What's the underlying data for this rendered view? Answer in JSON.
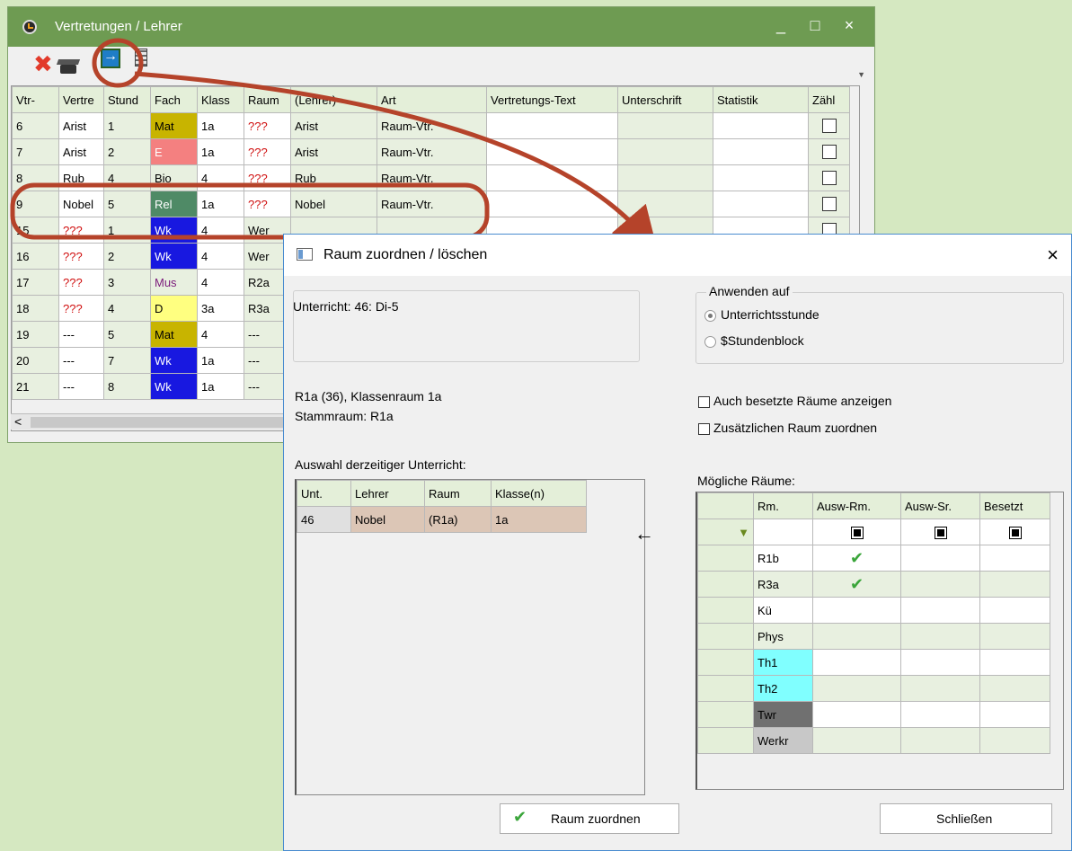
{
  "main_window": {
    "title": "Vertretungen / Lehrer",
    "controls": {
      "minimize": "_",
      "maximize": "□",
      "close": "×"
    },
    "toolbar_icons": [
      "delete-icon",
      "teacher-hat-icon",
      "assign-room-icon",
      "room-grid-icon"
    ],
    "columns": [
      "Vtr-",
      "Vertre",
      "Stund",
      "Fach",
      "Klass",
      "Raum",
      "(Lehrer)",
      "Art",
      "Vertretungs-Text",
      "Unterschrift",
      "Statistik",
      "Zähl"
    ],
    "rows": [
      {
        "vtr": "6",
        "vertr": "Arist",
        "stunde": "1",
        "fach": "Mat",
        "klasse": "1a",
        "raum": "???",
        "lehrer": "Arist",
        "art": "Raum-Vtr."
      },
      {
        "vtr": "7",
        "vertr": "Arist",
        "stunde": "2",
        "fach": "E",
        "klasse": "1a",
        "raum": "???",
        "lehrer": "Arist",
        "art": "Raum-Vtr."
      },
      {
        "vtr": "8",
        "vertr": "Rub",
        "stunde": "4",
        "fach": "Bio",
        "klasse": "4",
        "raum": "???",
        "lehrer": "Rub",
        "art": "Raum-Vtr."
      },
      {
        "vtr": "9",
        "vertr": "Nobel",
        "stunde": "5",
        "fach": "Rel",
        "klasse": "1a",
        "raum": "???",
        "lehrer": "Nobel",
        "art": "Raum-Vtr."
      },
      {
        "vtr": "15",
        "vertr": "???",
        "stunde": "1",
        "fach": "Wk",
        "klasse": "4",
        "raum": "Wer",
        "lehrer": "",
        "art": ""
      },
      {
        "vtr": "16",
        "vertr": "???",
        "stunde": "2",
        "fach": "Wk",
        "klasse": "4",
        "raum": "Wer",
        "lehrer": "",
        "art": ""
      },
      {
        "vtr": "17",
        "vertr": "???",
        "stunde": "3",
        "fach": "Mus",
        "klasse": "4",
        "raum": "R2a",
        "lehrer": "",
        "art": ""
      },
      {
        "vtr": "18",
        "vertr": "???",
        "stunde": "4",
        "fach": "D",
        "klasse": "3a",
        "raum": "R3a",
        "lehrer": "",
        "art": ""
      },
      {
        "vtr": "19",
        "vertr": "---",
        "stunde": "5",
        "fach": "Mat",
        "klasse": "4",
        "raum": "---",
        "lehrer": "",
        "art": ""
      },
      {
        "vtr": "20",
        "vertr": "---",
        "stunde": "7",
        "fach": "Wk",
        "klasse": "1a",
        "raum": "---",
        "lehrer": "",
        "art": ""
      },
      {
        "vtr": "21",
        "vertr": "---",
        "stunde": "8",
        "fach": "Wk",
        "klasse": "1a",
        "raum": "---",
        "lehrer": "",
        "art": ""
      }
    ],
    "scroll_left": "<"
  },
  "dialog": {
    "title": "Raum zuordnen / löschen",
    "close": "×",
    "unterricht_info": "Unterricht: 46: Di-5",
    "apply_to": {
      "legend": "Anwenden auf",
      "options": [
        "Unterrichtsstunde",
        "$Stundenblock"
      ],
      "selected": "Unterrichtsstunde"
    },
    "checkbox_occupied": "Auch besetzte Räume anzeigen",
    "checkbox_additional": "Zusätzlichen Raum zuordnen",
    "room_info_line1": "R1a (36), Klassenraum 1a",
    "room_info_line2": "Stammraum: R1a",
    "current_selection_label": "Auswahl derzeitiger Unterricht:",
    "current_selection": {
      "columns": [
        "Unt.",
        "Lehrer",
        "Raum",
        "Klasse(n)"
      ],
      "rows": [
        {
          "unt": "46",
          "lehrer": "Nobel",
          "raum": "(R1a)",
          "klasse": "1a"
        }
      ]
    },
    "arrow": "←",
    "possible_rooms_label": "Mögliche Räume:",
    "possible_rooms": {
      "columns": [
        "Rm.",
        "Ausw-Rm.",
        "Ausw-Sr.",
        "Besetzt"
      ],
      "rows": [
        {
          "rm": "R1b",
          "ausw_rm": "✔"
        },
        {
          "rm": "R3a",
          "ausw_rm": "✔"
        },
        {
          "rm": "Kü",
          "ausw_rm": ""
        },
        {
          "rm": "Phys",
          "ausw_rm": ""
        },
        {
          "rm": "Th1",
          "ausw_rm": ""
        },
        {
          "rm": "Th2",
          "ausw_rm": ""
        },
        {
          "rm": "Twr",
          "ausw_rm": ""
        },
        {
          "rm": "Werkr",
          "ausw_rm": ""
        }
      ]
    },
    "btn_assign": "Raum zuordnen",
    "btn_close": "Schließen"
  },
  "colors": {
    "background": "#d5e8c1",
    "titlebar": "#6e9b52",
    "annotation": "#b5432a",
    "dialog_border": "#4a8cd0"
  }
}
